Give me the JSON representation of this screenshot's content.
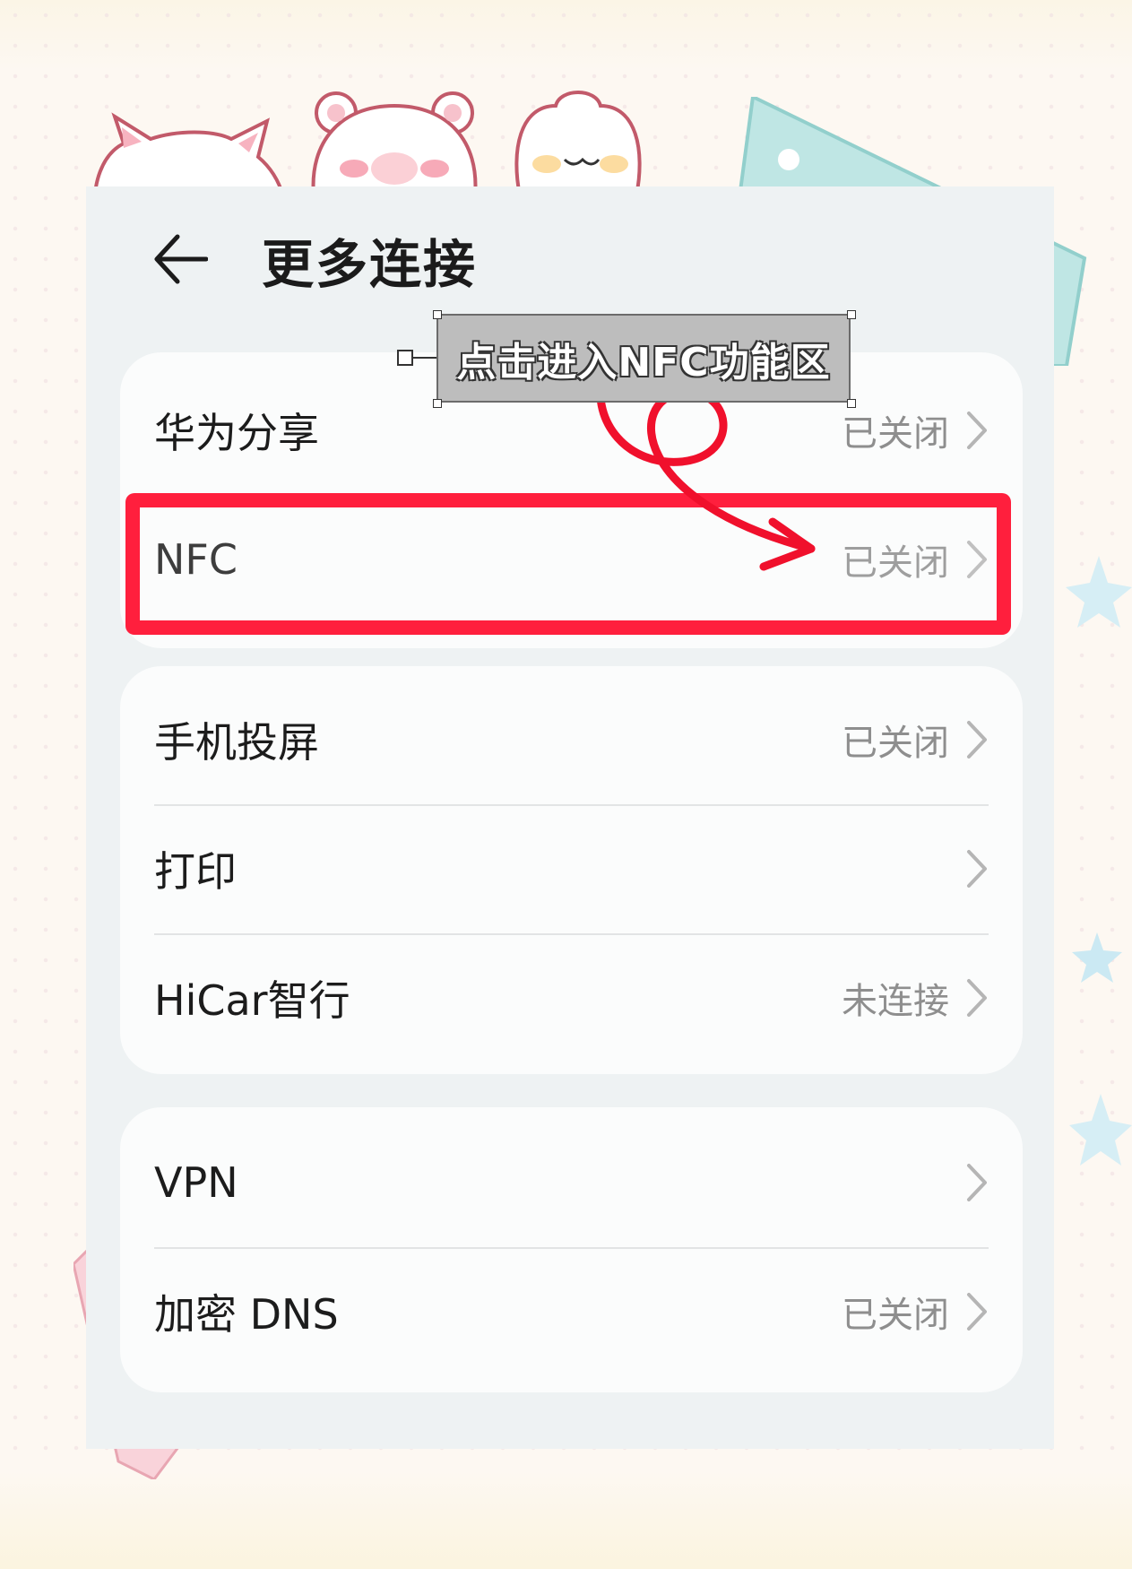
{
  "header": {
    "title": "更多连接"
  },
  "groups": [
    {
      "rows": [
        {
          "label": "华为分享",
          "value": "已关闭"
        },
        {
          "label": "NFC",
          "value": "已关闭"
        }
      ]
    },
    {
      "rows": [
        {
          "label": "手机投屏",
          "value": "已关闭"
        },
        {
          "label": "打印",
          "value": ""
        },
        {
          "label": "HiCar智行",
          "value": "未连接"
        }
      ]
    },
    {
      "rows": [
        {
          "label": "VPN",
          "value": ""
        },
        {
          "label": "加密 DNS",
          "value": "已关闭"
        }
      ]
    }
  ],
  "annotation": {
    "callout_text": "点击进入NFC功能区",
    "highlight_color": "#ff1f3d"
  },
  "icons": {
    "back": "arrow-left-icon",
    "chevron": "chevron-right-icon"
  }
}
